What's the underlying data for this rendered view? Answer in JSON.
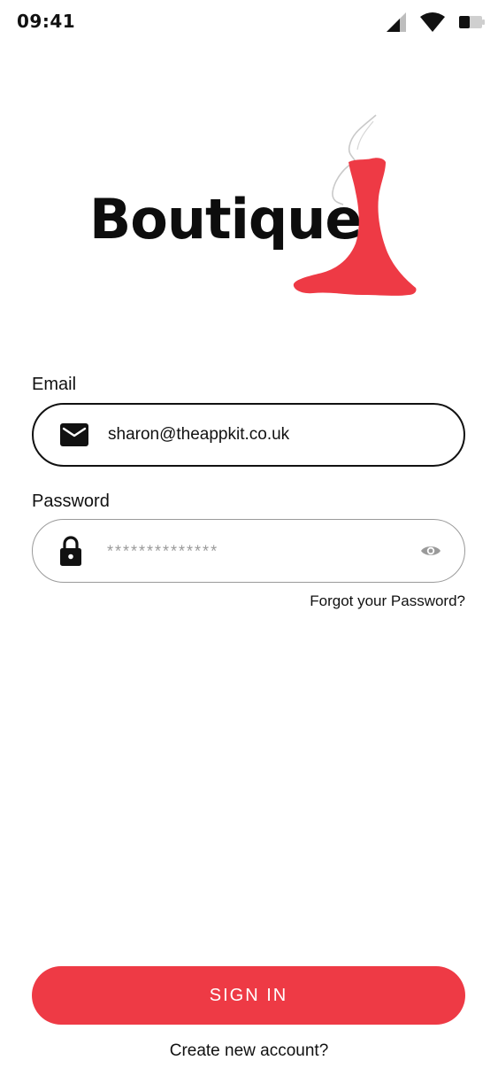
{
  "status_bar": {
    "time": "09:41",
    "icons": [
      "cellular-signal-icon",
      "wifi-icon",
      "battery-icon"
    ]
  },
  "logo": {
    "text": "Boutique",
    "image": "red-dress-icon"
  },
  "login_form": {
    "email_label": "Email",
    "email_value": "sharon@theappkit.co.uk",
    "email_icon": "mail-icon",
    "password_label": "Password",
    "password_placeholder": "**************",
    "password_icon": "lock-icon",
    "visibility_icon": "eye-icon",
    "forgot_password": "Forgot your Password?"
  },
  "actions": {
    "sign_in_label": "SIGN IN",
    "create_account_label": "Create new account?"
  },
  "colors": {
    "accent": "#ee3a45",
    "text": "#111111",
    "muted": "#9a9a9a",
    "background": "#ffffff"
  }
}
